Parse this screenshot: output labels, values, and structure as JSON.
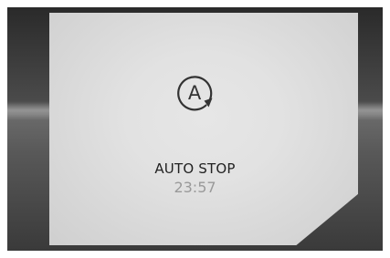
{
  "display": {
    "icon": "auto-stop-icon",
    "icon_letter": "A",
    "status_label": "AUTO STOP",
    "time": "23:57"
  },
  "colors": {
    "panel": "#e3e3e3",
    "status_text": "#222222",
    "time_text": "#9a9a9a",
    "background": "#4a4a4a"
  }
}
